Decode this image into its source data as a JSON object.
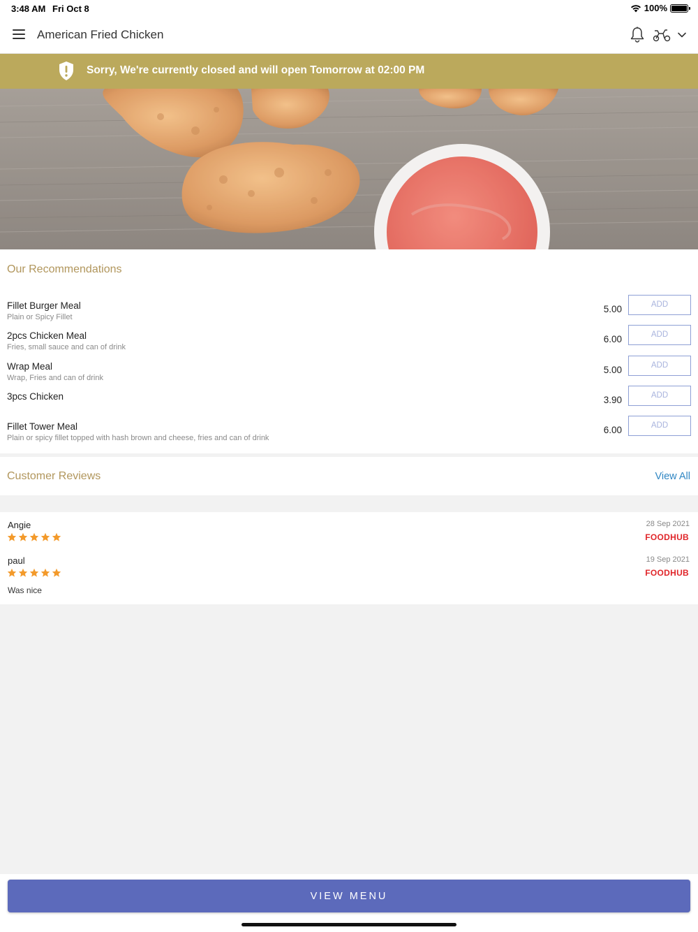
{
  "status_bar": {
    "time": "3:48 AM",
    "date": "Fri Oct 8",
    "battery": "100%"
  },
  "header": {
    "title": "American Fried Chicken",
    "icons": [
      "menu-icon",
      "bell-icon",
      "scooter-icon",
      "chevron-down-icon"
    ]
  },
  "banner": {
    "message": "Sorry, We're currently closed and will open Tomorrow at 02:00 PM",
    "color": "#bba95c",
    "icon": "shield-alert-icon"
  },
  "recommendations": {
    "title": "Our Recommendations",
    "items": [
      {
        "name": "Fillet Burger Meal",
        "description": "Plain or Spicy Fillet",
        "price": "5.00",
        "button": "ADD"
      },
      {
        "name": "2pcs Chicken Meal",
        "description": "Fries, small sauce and can of drink",
        "price": "6.00",
        "button": "ADD"
      },
      {
        "name": "Wrap Meal",
        "description": "Wrap, Fries and can of drink",
        "price": "5.00",
        "button": "ADD"
      },
      {
        "name": "3pcs Chicken",
        "description": "",
        "price": "3.90",
        "button": "ADD"
      },
      {
        "name": "Fillet Tower Meal",
        "description": "Plain or spicy fillet topped with hash brown and cheese, fries and can of drink",
        "price": "6.00",
        "button": "ADD"
      }
    ]
  },
  "reviews": {
    "title": "Customer Reviews",
    "view_all": "View All",
    "items": [
      {
        "name": "Angie",
        "rating": 5,
        "date": "28 Sep 2021",
        "source": "FOODHUB",
        "text": ""
      },
      {
        "name": "paul",
        "rating": 5,
        "date": "19 Sep 2021",
        "source": "FOODHUB",
        "text": "Was nice"
      }
    ]
  },
  "footer": {
    "view_menu": "VIEW MENU",
    "accent": "#5c6abb"
  }
}
